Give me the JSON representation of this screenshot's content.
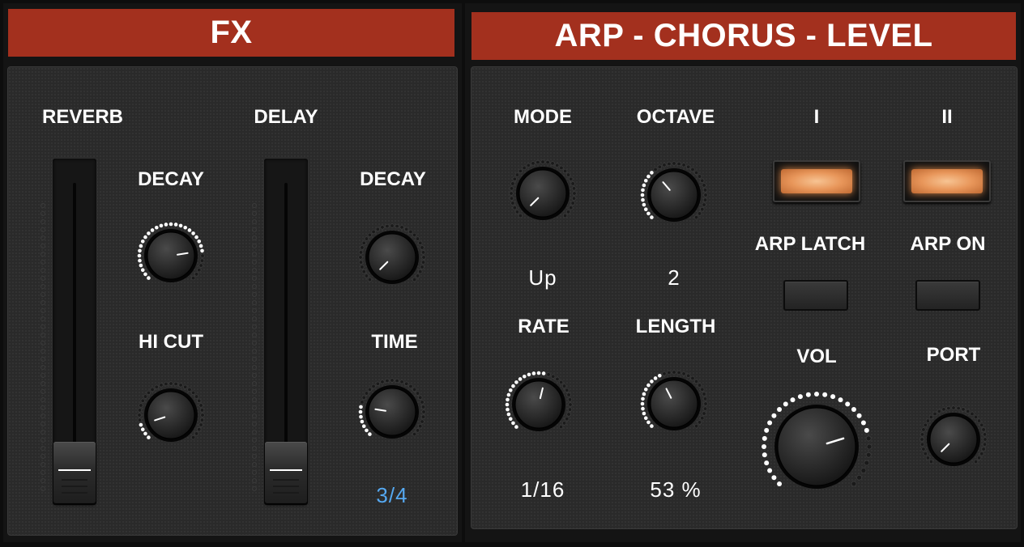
{
  "fx": {
    "title": "FX",
    "reverb": {
      "label": "REVERB",
      "fader_level": 0.0,
      "decay": {
        "label": "DECAY",
        "value": 0.8
      },
      "hi_cut": {
        "label": "HI CUT",
        "value": 0.1
      }
    },
    "delay": {
      "label": "DELAY",
      "fader_level": 0.0,
      "decay": {
        "label": "DECAY",
        "value": 0.0
      },
      "time": {
        "label": "TIME",
        "value": 0.2,
        "display": "3/4"
      }
    }
  },
  "arp": {
    "title": "ARP - CHORUS - LEVEL",
    "mode": {
      "label": "MODE",
      "value": 0.0,
      "display": "Up"
    },
    "octave": {
      "label": "OCTAVE",
      "value": 0.35,
      "display": "2"
    },
    "rate": {
      "label": "RATE",
      "value": 0.55,
      "display": "1/16"
    },
    "length": {
      "label": "LENGTH",
      "value": 0.4,
      "display": "53 %"
    },
    "chorus_1": {
      "label": "I",
      "on": true
    },
    "chorus_2": {
      "label": "II",
      "on": true
    },
    "arp_latch": {
      "label": "ARP LATCH",
      "on": false
    },
    "arp_on": {
      "label": "ARP ON",
      "on": false
    },
    "vol": {
      "label": "VOL",
      "value": 0.77
    },
    "port": {
      "label": "PORT",
      "value": 0.0
    }
  },
  "colors": {
    "header": "#a3301e",
    "accent_value": "#55a8f0",
    "lamp": "#e8965a"
  }
}
